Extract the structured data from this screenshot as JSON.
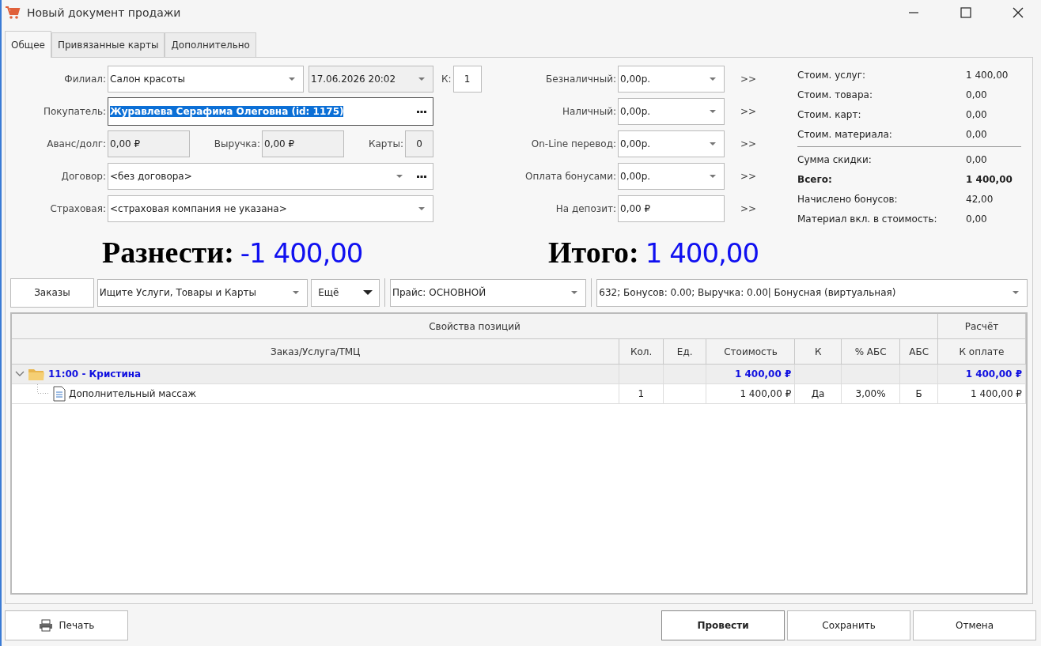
{
  "window": {
    "title": "Новый документ продажи"
  },
  "tabs": [
    {
      "label": "Общее",
      "selected": true
    },
    {
      "label": "Привязанные карты",
      "selected": false
    },
    {
      "label": "Дополнительно",
      "selected": false
    }
  ],
  "form": {
    "branch": {
      "label": "Филиал:",
      "value": "Салон красоты"
    },
    "date": {
      "value": "17.06.2026 20:02"
    },
    "k": {
      "label": "К:",
      "value": "1"
    },
    "buyer": {
      "label": "Покупатель:",
      "value": "Журавлева Серафима Олеговна (id: 1175)",
      "selected": true
    },
    "advance": {
      "label": "Аванс/долг:",
      "value": "0,00 ₽"
    },
    "revenue": {
      "label": "Выручка:",
      "value": "0,00 ₽"
    },
    "cards": {
      "label": "Карты:",
      "value": "0"
    },
    "contract": {
      "label": "Договор:",
      "value": "<без договора>"
    },
    "insurance": {
      "label": "Страховая:",
      "value": "<страховая компания не указана>"
    }
  },
  "payments": [
    {
      "label": "Безналичный:",
      "value": "0,00р.",
      "kind": "dropdown",
      "action": ">>"
    },
    {
      "label": "Наличный:",
      "value": "0,00р.",
      "kind": "dropdown",
      "action": ">>"
    },
    {
      "label": "On-Line перевод:",
      "value": "0,00р.",
      "kind": "dropdown",
      "action": ">>"
    },
    {
      "label": "Оплата бонусами:",
      "value": "0,00р.",
      "kind": "dropdown",
      "action": ">>"
    },
    {
      "label": "На депозит:",
      "value": "0,00 ₽",
      "kind": "plain",
      "action": ">>"
    }
  ],
  "summary": [
    {
      "label": "Стоим. услуг:",
      "value": "1 400,00",
      "bold": false,
      "divider_before": false
    },
    {
      "label": "Стоим. товара:",
      "value": "0,00",
      "bold": false,
      "divider_before": false
    },
    {
      "label": "Стоим. карт:",
      "value": "0,00",
      "bold": false,
      "divider_before": false
    },
    {
      "label": "Стоим. материала:",
      "value": "0,00",
      "bold": false,
      "divider_before": false
    },
    {
      "label": "Сумма скидки:",
      "value": "0,00",
      "bold": false,
      "divider_before": true
    },
    {
      "label": "Всего:",
      "value": "1 400,00",
      "bold": true,
      "divider_before": false
    },
    {
      "label": "Начислено бонусов:",
      "value": "42,00",
      "bold": false,
      "divider_before": false
    },
    {
      "label": "Материал вкл. в стоимость:",
      "value": "0,00",
      "bold": false,
      "divider_before": false
    }
  ],
  "totals": [
    {
      "label": "Разнести:",
      "value": "-1 400,00"
    },
    {
      "label": "Итого:",
      "value": "1 400,00"
    }
  ],
  "toolbar": {
    "orders_button": "Заказы",
    "search": {
      "placeholder": "Ищите Услуги, Товары и Карты"
    },
    "more_button": "Ещё",
    "price": "Прайс: ОСНОВНОЙ",
    "card": "632; Бонусов: 0.00; Выручка: 0.00| Бонусная (виртуальная)"
  },
  "table": {
    "column_groups": [
      "Свойства позиций",
      "Расчёт"
    ],
    "columns": [
      "Заказ/Услуга/ТМЦ",
      "Кол.",
      "Ед.",
      "Стоимость",
      "К",
      "% АБС",
      "АБС",
      "К оплате"
    ],
    "rows": [
      {
        "kind": "group",
        "expanded": true,
        "cells": [
          "11:00 - Кристина",
          "",
          "",
          "1 400,00 ₽",
          "",
          "",
          "",
          "1 400,00 ₽"
        ],
        "children": [
          {
            "kind": "item",
            "cells": [
              "Дополнительный массаж",
              "1",
              "",
              "1 400,00 ₽",
              "Да",
              "3,00%",
              "Б",
              "1 400,00 ₽"
            ]
          }
        ]
      }
    ]
  },
  "footer": [
    {
      "label": "Печать",
      "kind": "print",
      "default": false
    },
    {
      "label": "Провести",
      "kind": "text",
      "default": true
    },
    {
      "label": "Сохранить",
      "kind": "text",
      "default": false
    },
    {
      "label": "Отмена",
      "kind": "text",
      "default": false
    }
  ]
}
